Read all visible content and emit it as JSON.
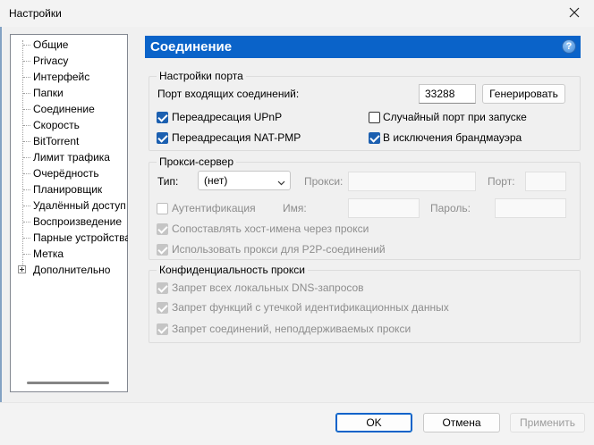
{
  "window": {
    "title": "Настройки"
  },
  "tree": {
    "items": [
      {
        "label": "Общие"
      },
      {
        "label": "Privacy"
      },
      {
        "label": "Интерфейс"
      },
      {
        "label": "Папки"
      },
      {
        "label": "Соединение"
      },
      {
        "label": "Скорость"
      },
      {
        "label": "BitTorrent"
      },
      {
        "label": "Лимит трафика"
      },
      {
        "label": "Очерёдность"
      },
      {
        "label": "Планировщик"
      },
      {
        "label": "Удалённый доступ"
      },
      {
        "label": "Воспроизведение"
      },
      {
        "label": "Парные устройства"
      },
      {
        "label": "Метка"
      },
      {
        "label": "Дополнительно"
      }
    ],
    "selected": "Соединение"
  },
  "page": {
    "title": "Соединение",
    "help_label": "?"
  },
  "port": {
    "legend": "Настройки порта",
    "incoming_label": "Порт входящих соединений:",
    "incoming_value": "33288",
    "generate_label": "Генерировать",
    "upnp_label": "Переадресация UPnP",
    "natpmp_label": "Переадресация NAT-PMP",
    "random_label": "Случайный порт при запуске",
    "firewall_label": "В исключения брандмауэра"
  },
  "proxy": {
    "legend": "Прокси-сервер",
    "type_label": "Тип:",
    "type_value": "(нет)",
    "proxy_label": "Прокси:",
    "port_label": "Порт:",
    "auth_label": "Аутентификация",
    "name_label": "Имя:",
    "password_label": "Пароль:",
    "resolve_label": "Сопоставлять хост-имена через прокси",
    "p2p_label": "Использовать прокси для P2P-соединений"
  },
  "privacy": {
    "legend": "Конфиденциальность прокси",
    "dns_label": "Запрет всех локальных DNS-запросов",
    "leak_label": "Запрет функций с утечкой идентификационных данных",
    "unsupported_label": "Запрет соединений, неподдерживаемых прокси"
  },
  "footer": {
    "ok_label": "OK",
    "cancel_label": "Отмена",
    "apply_label": "Применить"
  }
}
